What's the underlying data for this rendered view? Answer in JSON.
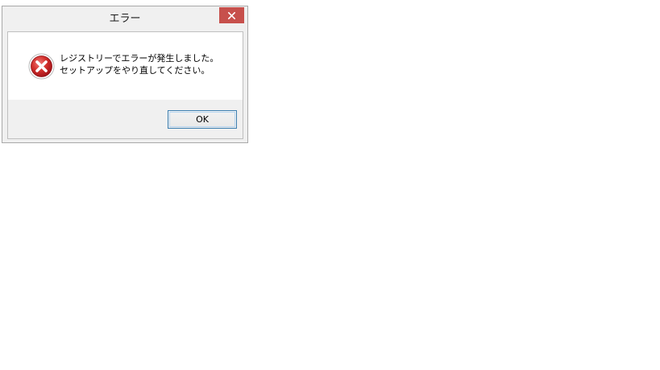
{
  "dialog": {
    "title": "エラー",
    "message_lines": [
      "レジストリーでエラーが発生しました。",
      "セットアップをやり直してください。"
    ],
    "ok_label": "OK",
    "close_glyph": "✕",
    "icon": "error-icon",
    "colors": {
      "close_button": "#c7504c",
      "error_icon": "#c8201f",
      "ok_border": "#3c7fb1"
    }
  }
}
